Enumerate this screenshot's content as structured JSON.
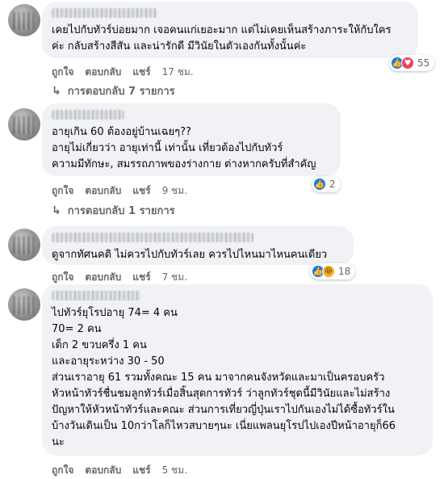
{
  "comments": [
    {
      "text": "เคยไปกับทัวร์บ่อยมาก เจอคนแก่เยอะมาก แต่ไม่เคยเห็นสร้างภาระให้กับใคร\nค่ะ กลับสร้างสีสัน และน่ารักดี มีวินัยในตัวเองกันทั้งนั้นค่ะ",
      "like_label": "ถูกใจ",
      "reply_label": "ตอบกลับ",
      "share_label": "แชร์",
      "time": "17 ชม.",
      "reaction_icons": [
        "like",
        "love"
      ],
      "reaction_count": "55",
      "replies_label": "การตอบกลับ 7 รายการ"
    },
    {
      "text": "อายุเกิน 60 ต้องอยู่บ้านเฉยๆ??\nอายุไม่เกี่ยวว่า อายุเท่านี้ เท่านั้น เที่ยวต้องไปกับทัวร์\nความมีทักษะ, สมรรถภาพของร่างกาย ต่างหากครับที่สำคัญ",
      "like_label": "ถูกใจ",
      "reply_label": "ตอบกลับ",
      "share_label": "แชร์",
      "time": "9 ชม.",
      "reaction_icons": [
        "like"
      ],
      "reaction_count": "2",
      "replies_label": "การตอบกลับ 1 รายการ"
    },
    {
      "text": "ดูจากทัศนคติ ไม่ควรไปกับทัวร์เลย ควรไปไหนมาไหนคนเดียว",
      "like_label": "ถูกใจ",
      "reply_label": "ตอบกลับ",
      "share_label": "แชร์",
      "time": "7 ชม.",
      "reaction_icons": [
        "like",
        "haha"
      ],
      "reaction_count": "18"
    },
    {
      "text": "ไปทัวร์ยุโรปอายุ 74= 4 คน\n70= 2 คน\nเด็ก 2 ขวบครึ่ง 1 คน\nและอายุระหว่าง 30 - 50\nส่วนเราอายุ 61 รวมทั้งคณะ 15 คน มาจากคนจังหวัดและมาเป็นครอบครัว\nหัวหน้าทัวร์ชื่นชมลูกทัวร์เมื่อสิ้นสุดการทัวร์ ว่าลูกทัวร์ชุดนี้มีวินัยและไม่สร้าง\nปัญหาให้หัวหน้าทัวร์และคณะ ส่วนการเที่ยวญี่ปุ่นเราไปกันเองไม่ได้ซื้อทัวร์ใน\nบ้างวันเดินเป็น 10กว่าโลก็ไหวสบายๆนะ เนี่ยแพลนยุโรปไปเองปีหน้าอายุก็66\nนะ",
      "like_label": "ถูกใจ",
      "reply_label": "ตอบกลับ",
      "share_label": "แชร์",
      "time": "5 ชม."
    }
  ],
  "icons": {
    "reply_arrow": "↳",
    "like": "👍",
    "love": "♥",
    "haha": "😆"
  },
  "colors": {
    "bubble": "#f0f2f5",
    "meta_text": "#65676b",
    "like_blue": "#1877f2",
    "love_red": "#f33e58",
    "haha_yellow": "#f7b125"
  }
}
